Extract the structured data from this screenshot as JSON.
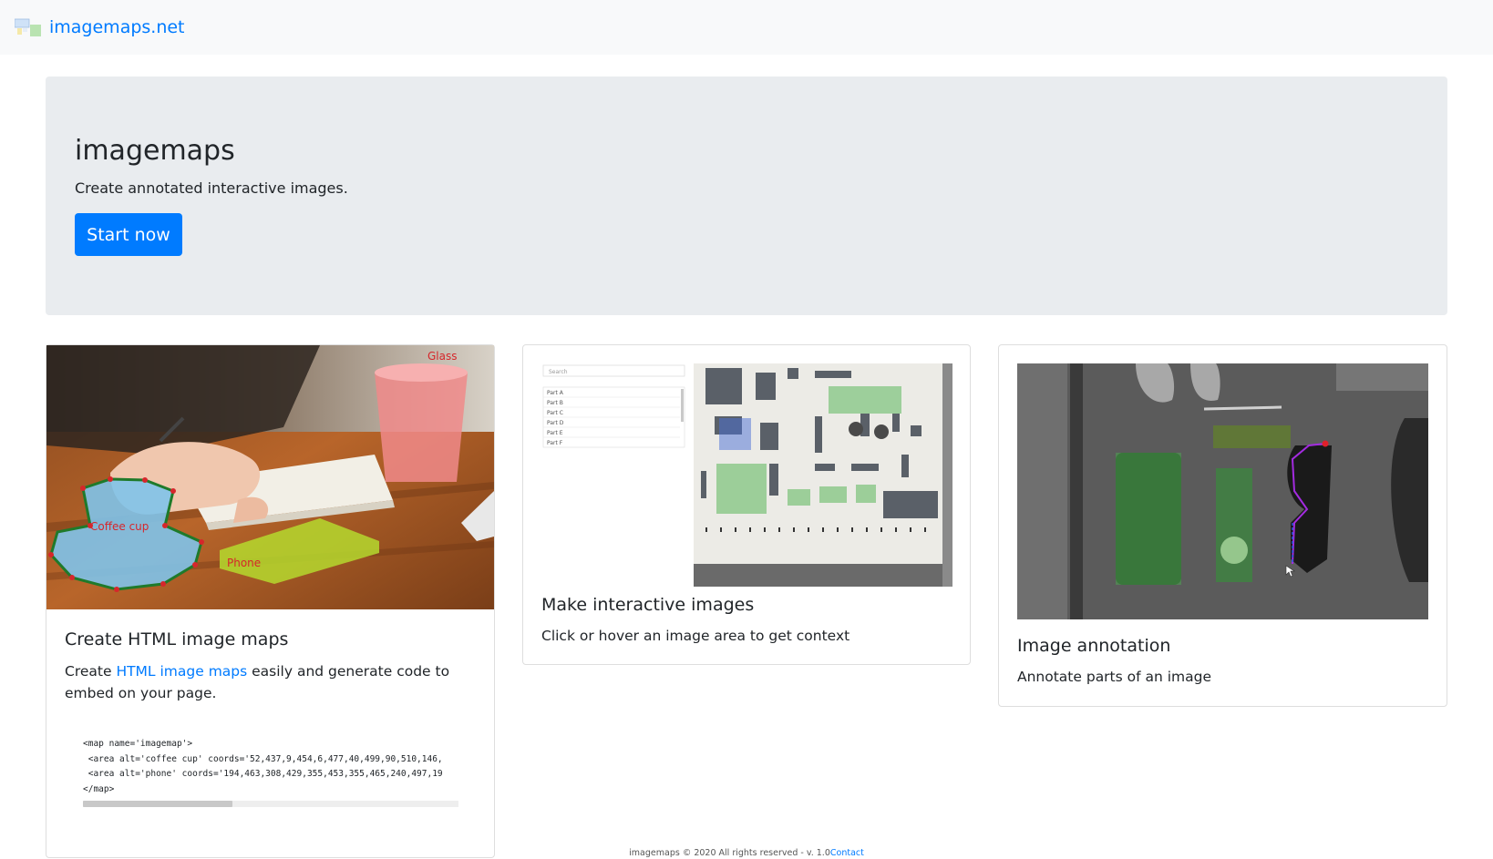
{
  "navbar": {
    "brand_name": "imagemaps.net",
    "logo_icon": "imagemaps-logo-icon"
  },
  "hero": {
    "title": "imagemaps",
    "lead": "Create annotated interactive images.",
    "cta_label": "Start now"
  },
  "cards": [
    {
      "title": "Create HTML image maps",
      "text_before": "Create ",
      "link_text": "HTML image maps",
      "text_after": " easily and generate code to embed on your page.",
      "image_labels": [
        "Glass",
        "Coffee cup",
        "Phone"
      ],
      "code_lines": [
        "<map name='imagemap'>",
        " <area alt='coffee cup' coords='52,437,9,454,6,477,40,499,90,510,146,",
        " <area alt='phone' coords='194,463,308,429,355,453,355,465,240,497,19",
        "</map>"
      ]
    },
    {
      "title": "Make interactive images",
      "text": "Click or hover an image area to get context",
      "search_placeholder": "Search",
      "parts": [
        "Part A",
        "Part B",
        "Part C",
        "Part D",
        "Part E",
        "Part F"
      ]
    },
    {
      "title": "Image annotation",
      "text": "Annotate parts of an image"
    }
  ],
  "footer": {
    "text": "imagemaps © 2020 All rights reserved - v. 1.0",
    "contact_label": "Contact"
  },
  "colors": {
    "primary": "#007bff",
    "navbar_bg": "#f8f9fa",
    "jumbotron_bg": "#e9ecef"
  }
}
